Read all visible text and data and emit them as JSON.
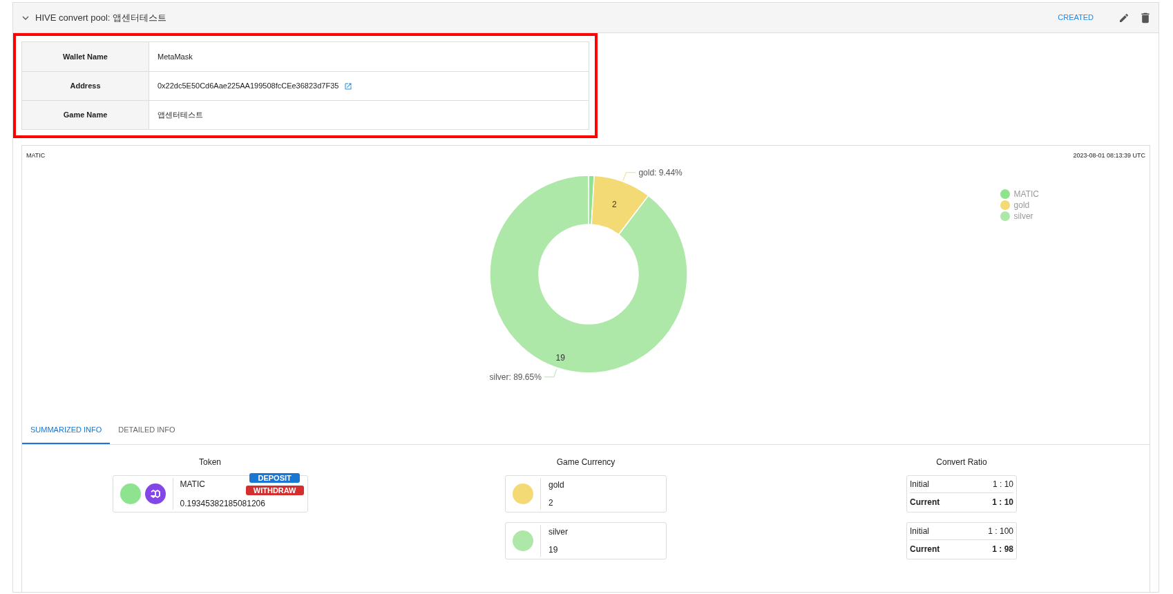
{
  "panel": {
    "title": "HIVE convert pool: 앱센터테스트",
    "expanded": true,
    "status": "CREATED"
  },
  "info_table": {
    "highlighted": true,
    "rows": [
      {
        "label": "Wallet Name",
        "value": "MetaMask",
        "kind": "text"
      },
      {
        "label": "Address",
        "value": "0x22dc5E50Cd6Aae225AA199508fcCEe36823d7F35",
        "kind": "address"
      },
      {
        "label": "Game Name",
        "value": "앱센터테스트",
        "kind": "text"
      }
    ]
  },
  "chart_card": {
    "title": "MATIC",
    "timestamp": "2023-08-01 08:13:39 UTC",
    "chart_data": {
      "type": "donut",
      "categories": [
        "MATIC",
        "gold",
        "silver"
      ],
      "values": [
        0.91,
        9.44,
        89.65
      ],
      "colors": [
        "#8ee38f",
        "#f3da75",
        "#aee8a8"
      ],
      "annotations": [
        null,
        "gold: 9.44%",
        "silver: 89.65%"
      ]
    },
    "slice_counts": [
      "2",
      "19"
    ]
  },
  "tabs": [
    {
      "label": "SUMMARIZED INFO",
      "selected": true
    },
    {
      "label": "DETAILED INFO",
      "selected": false
    }
  ],
  "token": {
    "heading": "Token",
    "items": [
      {
        "name": "MATIC",
        "amount": "0.19345382185081206",
        "color": "#8ee38f",
        "actions": [
          {
            "label": "DEPOSIT",
            "kind": "deposit"
          },
          {
            "label": "WITHDRAW",
            "kind": "withdraw"
          }
        ]
      }
    ]
  },
  "game_currency": {
    "heading": "Game Currency",
    "items": [
      {
        "name": "gold",
        "amount": "2",
        "color": "#f3da75"
      },
      {
        "name": "silver",
        "amount": "19",
        "color": "#aee8a8"
      }
    ]
  },
  "convert_ratio": {
    "heading": "Convert Ratio",
    "items": [
      {
        "initial_label": "Initial",
        "initial": "1 : 10",
        "current_label": "Current",
        "current": "1 : 10"
      },
      {
        "initial_label": "Initial",
        "initial": "1 : 100",
        "current_label": "Current",
        "current": "1 : 98"
      }
    ]
  }
}
